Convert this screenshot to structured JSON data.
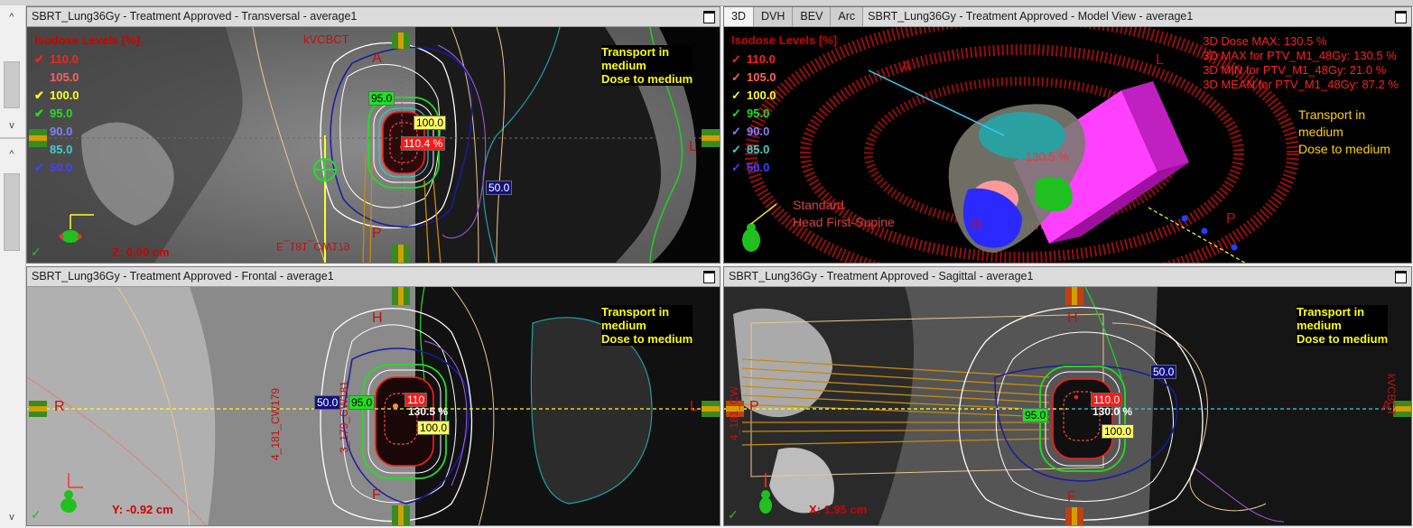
{
  "colors": {
    "dose110": "#ff1a1a",
    "dose105": "#ff5a5a",
    "dose100": "#ffff30",
    "dose95": "#20e020",
    "dose90": "#4a6bff",
    "dose85": "#3fd0d0",
    "dose50": "#1a1aa0",
    "ptv": "#ffffff",
    "skin": "#e8c890",
    "heart": "#20a0a0",
    "beam": "#c88a10"
  },
  "sidebar": {
    "up_icon": "^",
    "down_icon": "v"
  },
  "isodose": {
    "title": "Isodose Levels [%]",
    "levels": [
      {
        "value": "110.0",
        "color": "#ff2020",
        "check": "✔"
      },
      {
        "value": "105.0",
        "color": "#ff6060",
        "check": ""
      },
      {
        "value": "100.0",
        "color": "#ffff20",
        "check": "✔"
      },
      {
        "value": "95.0",
        "color": "#20e020",
        "check": "✔"
      },
      {
        "value": "90.0",
        "color": "#8080ff",
        "check": ""
      },
      {
        "value": "85.0",
        "color": "#40d0d0",
        "check": ""
      },
      {
        "value": "50.0",
        "color": "#4040ff",
        "check": "✔"
      }
    ],
    "levels3d": [
      {
        "value": "110.0",
        "color": "#ff2020",
        "check": "✓"
      },
      {
        "value": "105.0",
        "color": "#ff6060",
        "check": "✓"
      },
      {
        "value": "100.0",
        "color": "#ffff20",
        "check": "✓"
      },
      {
        "value": "95.0",
        "color": "#20e020",
        "check": "✓"
      },
      {
        "value": "90.0",
        "color": "#8080ff",
        "check": "✓"
      },
      {
        "value": "85.0",
        "color": "#40d0d0",
        "check": "✓"
      },
      {
        "value": "50.0",
        "color": "#4040ff",
        "check": "✓"
      }
    ]
  },
  "transport": {
    "line1": "Transport in",
    "line2": "medium",
    "line3": "Dose to medium"
  },
  "transversal": {
    "title": "SBRT_Lung36Gy  -  Treatment Approved - Transversal - average1",
    "orient_top": "A",
    "orient_bottom": "P",
    "orient_right": "L",
    "beam_label": "kVCBCT",
    "bottom_label": "E_181_CW179",
    "coord": "Z: 0.00 cm",
    "labels": {
      "l95": "95.0",
      "l100": "100.0",
      "l110": "110.4 %",
      "l50": "50.0"
    }
  },
  "model3d": {
    "tabs": [
      "3D",
      "DVH",
      "BEV",
      "Arc"
    ],
    "title": "SBRT_Lung36Gy  -  Treatment Approved - Model View - average1",
    "orient_A": "A",
    "orient_L": "L",
    "orient_R": "R",
    "orient_P": "P",
    "dose_label": "130.5 %",
    "stats": [
      "3D Dose MAX: 130.5 %",
      "3D MAX for PTV_M1_48Gy: 130.5 %",
      "3D MIN for PTV_M1_48Gy: 21.0 %",
      "3D MEAN for PTV_M1_48Gy: 87.2 %"
    ],
    "standard_line1": "Standard",
    "standard_line2": "Head First-Supine"
  },
  "frontal": {
    "title": "SBRT_Lung36Gy  -  Treatment Approved - Frontal - average1",
    "orient_top": "H",
    "orient_bottom": "F",
    "orient_left": "R",
    "orient_right": "L",
    "beam_left": "4_181_CW179",
    "beam_right": "3_179_CW181",
    "coord": "Y: -0.92 cm",
    "labels": {
      "l50": "50.0",
      "l95": "95.0",
      "l110": "110",
      "l130": "130.5 %",
      "l100": "100.0"
    }
  },
  "sagittal": {
    "title": "SBRT_Lung36Gy  -  Treatment Approved - Sagittal - average1",
    "orient_top": "H",
    "orient_bottom": "F",
    "orient_left": "P",
    "orient_right": "A",
    "beam_left": "4_181_CW",
    "beam_right": "kVCBCT",
    "coord": "X: 1.95 cm",
    "labels": {
      "l50": "50.0",
      "l110": "110.0",
      "l95": "95.0",
      "l130": "130.0 %",
      "l100": "100.0"
    }
  }
}
